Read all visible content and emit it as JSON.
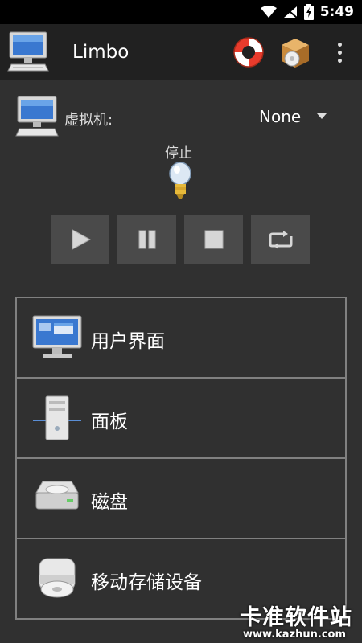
{
  "status_bar": {
    "time": "5:49",
    "icons": [
      "wifi-icon",
      "signal-icon",
      "battery-charging-icon"
    ]
  },
  "app_bar": {
    "title": "Limbo",
    "icons": [
      "monitor-logo-icon",
      "help-lifebuoy-icon",
      "package-cd-icon",
      "more-vert-icon"
    ]
  },
  "vm_selector": {
    "label": "虚拟机:",
    "selected": "None"
  },
  "vm_status": {
    "text": "停止"
  },
  "controls": [
    "play-icon",
    "pause-icon",
    "stop-icon",
    "restart-icon"
  ],
  "menu": {
    "items": [
      {
        "label": "用户界面",
        "icon": "user-interface-icon"
      },
      {
        "label": "面板",
        "icon": "server-board-icon"
      },
      {
        "label": "磁盘",
        "icon": "hard-disk-icon"
      },
      {
        "label": "移动存储设备",
        "icon": "removable-storage-icon"
      }
    ]
  },
  "watermark": {
    "main": "卡准软件站",
    "sub": "www.kazhun.com"
  },
  "colors": {
    "background": "#303030",
    "app_bar": "#212121",
    "status_bar": "#000000",
    "button": "#4a4a4a",
    "border": "#808080"
  }
}
